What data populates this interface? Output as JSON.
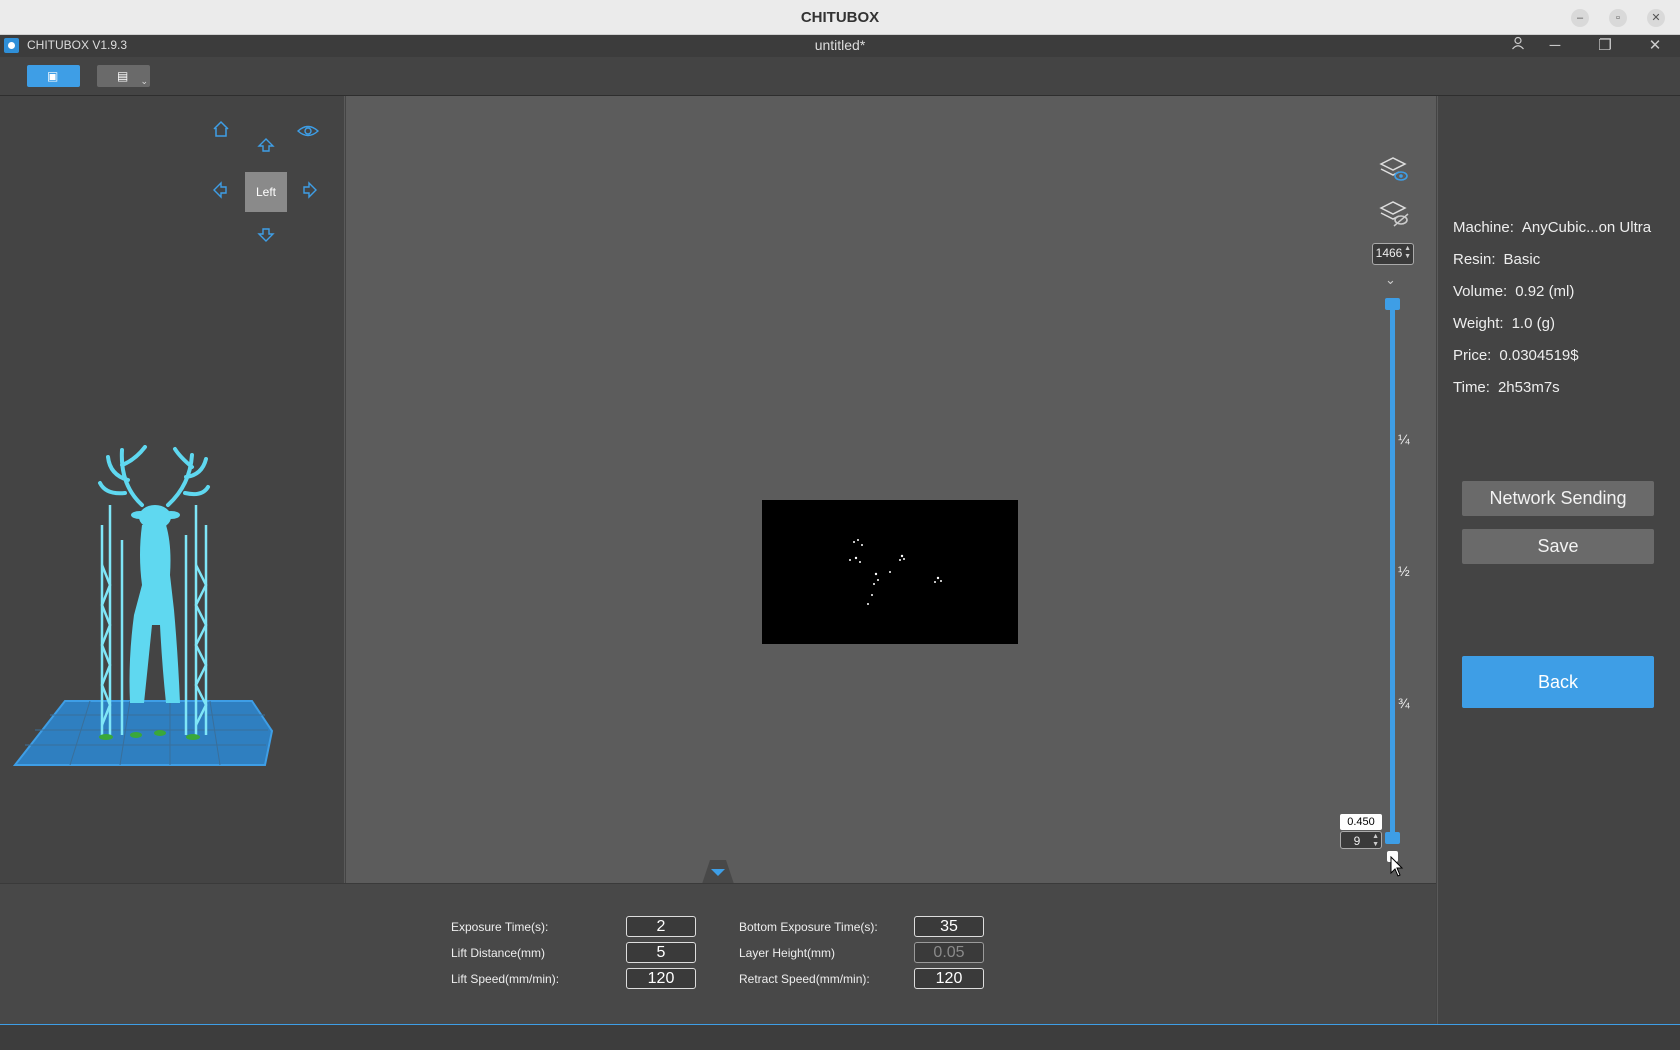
{
  "os_window": {
    "title": "CHITUBOX"
  },
  "app": {
    "name": "CHITUBOX V1.9.3",
    "document_title": "untitled*"
  },
  "view_cube": {
    "face_label": "Left"
  },
  "layer_slider": {
    "top_layer": "1466",
    "bottom_height": "0.450",
    "bottom_layer": "9",
    "marks": [
      "¼",
      "½",
      "¾"
    ]
  },
  "info": {
    "machine_label": "Machine:",
    "machine": "AnyCubic...on Ultra",
    "resin_label": "Resin:",
    "resin": "Basic",
    "volume_label": "Volume:",
    "volume": "0.92  (ml)",
    "weight_label": "Weight:",
    "weight": "1.0  (g)",
    "price_label": "Price:",
    "price": "0.0304519$",
    "time_label": "Time:",
    "time": "2h53m7s"
  },
  "buttons": {
    "network_sending": "Network Sending",
    "save": "Save",
    "back": "Back"
  },
  "settings": {
    "exposure_time_label": "Exposure Time(s):",
    "exposure_time": "2",
    "bottom_exposure_label": "Bottom Exposure Time(s):",
    "bottom_exposure": "35",
    "lift_distance_label": "Lift Distance(mm)",
    "lift_distance": "5",
    "layer_height_label": "Layer Height(mm)",
    "layer_height": "0.05",
    "lift_speed_label": "Lift Speed(mm/min):",
    "lift_speed": "120",
    "retract_speed_label": "Retract Speed(mm/min):",
    "retract_speed": "120"
  },
  "colors": {
    "accent": "#3e9ee6",
    "model": "#5fd8f0",
    "support_base": "#3aa83a"
  }
}
